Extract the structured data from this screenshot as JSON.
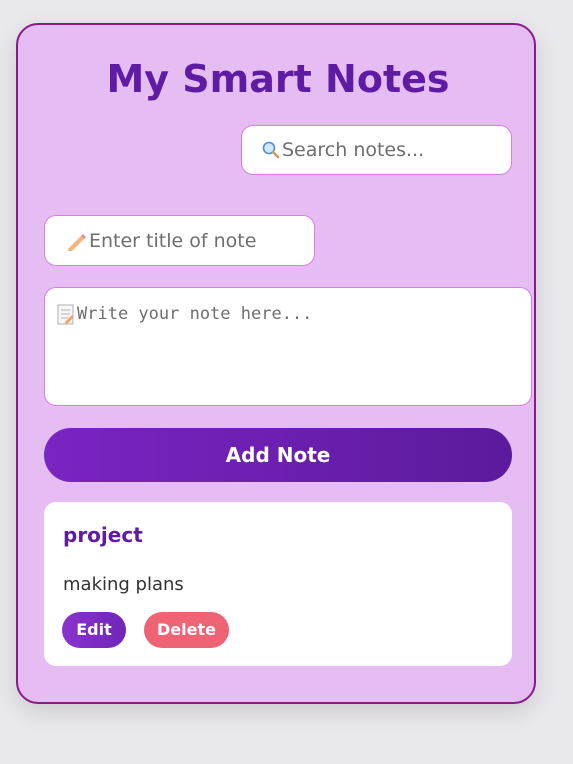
{
  "app": {
    "title": "My Smart Notes"
  },
  "search": {
    "icon": "search-icon",
    "placeholder": "Search notes..."
  },
  "new_note": {
    "title_icon": "pencil-icon",
    "title_placeholder": "Enter title of note",
    "body_icon": "memo-icon",
    "body_placeholder": "Write your note here...",
    "add_label": "Add Note"
  },
  "notes": [
    {
      "title": "project",
      "body": "making plans",
      "edit_label": "Edit",
      "delete_label": "Delete"
    }
  ],
  "colors": {
    "accent": "#5e1ba3",
    "panel": "#e5bdf2",
    "border": "#8a1a8a",
    "delete": "#ee6474"
  }
}
